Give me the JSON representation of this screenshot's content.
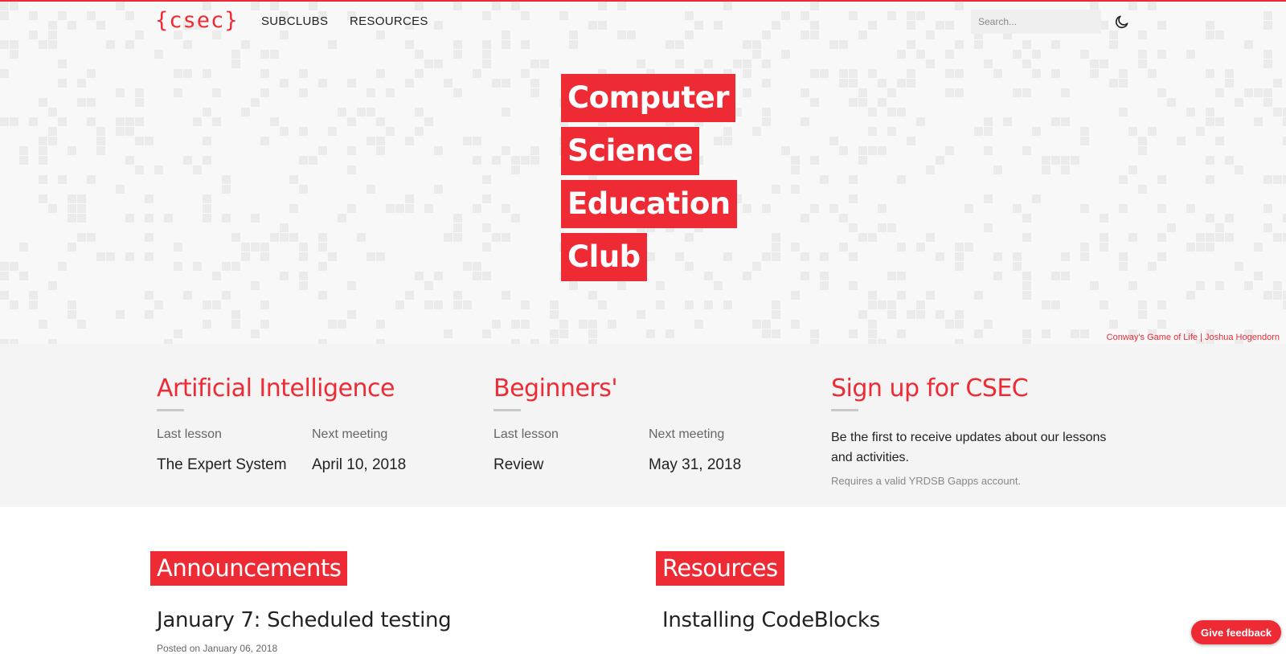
{
  "nav": {
    "logo": "{csec}",
    "links": [
      "SUBCLUBS",
      "RESOURCES"
    ],
    "search_placeholder": "Search...",
    "theme_toggle_icon": "moon-icon"
  },
  "hero": {
    "title_words": [
      "Computer",
      "Science",
      "Education",
      "Club"
    ],
    "credit_text": "Conway's Game of Life",
    "credit_sep": " | ",
    "credit_author": "Joshua Hogendorn"
  },
  "subclubs": [
    {
      "name": "Artificial Intelligence",
      "last_label": "Last lesson",
      "last_value": "The Expert System",
      "next_label": "Next meeting",
      "next_value": "April 10, 2018"
    },
    {
      "name": "Beginners'",
      "last_label": "Last lesson",
      "last_value": "Review",
      "next_label": "Next meeting",
      "next_value": "May 31, 2018"
    }
  ],
  "signup": {
    "title": "Sign up for CSEC",
    "text": "Be the first to receive updates about our lessons and activities.",
    "note": "Requires a valid YRDSB Gapps account."
  },
  "announcements": {
    "heading": "Announcements",
    "post_title": "January 7: Scheduled testing",
    "post_meta": "Posted on January 06, 2018"
  },
  "resources": {
    "heading": "Resources",
    "post_title": "Installing CodeBlocks"
  },
  "feedback_button": "Give feedback",
  "colors": {
    "accent": "#ee2a34",
    "band_bg": "#f4f4f4",
    "hero_bg": "#f8f8f8",
    "life_cell": "#ebebeb"
  }
}
